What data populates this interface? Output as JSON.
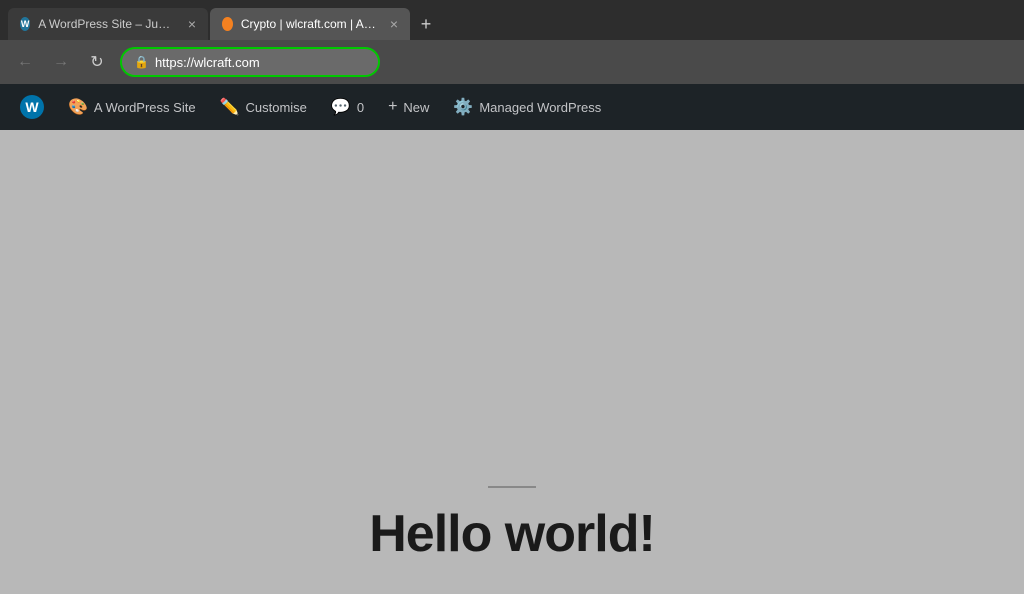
{
  "browser": {
    "tabs": [
      {
        "id": "tab1",
        "favicon_type": "wp",
        "title": "A WordPress Site – Just another W",
        "active": false
      },
      {
        "id": "tab2",
        "favicon_type": "cf",
        "title": "Crypto | wlcraft.com | Account | C",
        "active": true
      }
    ],
    "new_tab_label": "+",
    "nav": {
      "back_label": "←",
      "forward_label": "→",
      "refresh_label": "↻"
    },
    "url_bar": {
      "lock_icon": "🔒",
      "url": "https://wlcraft.com"
    }
  },
  "wp_admin_bar": {
    "items": [
      {
        "id": "wp-logo",
        "label": "W",
        "type": "logo"
      },
      {
        "id": "site-name",
        "icon": "🎨",
        "label": "A WordPress Site"
      },
      {
        "id": "customise",
        "icon": "✏️",
        "label": "Customise"
      },
      {
        "id": "comments",
        "icon": "💬",
        "label": "0"
      },
      {
        "id": "new",
        "icon": "+",
        "label": "New"
      },
      {
        "id": "managed-wp",
        "icon": "⚙️",
        "label": "Managed WordPress"
      }
    ]
  },
  "page": {
    "divider": "",
    "title": "Hello world!"
  }
}
